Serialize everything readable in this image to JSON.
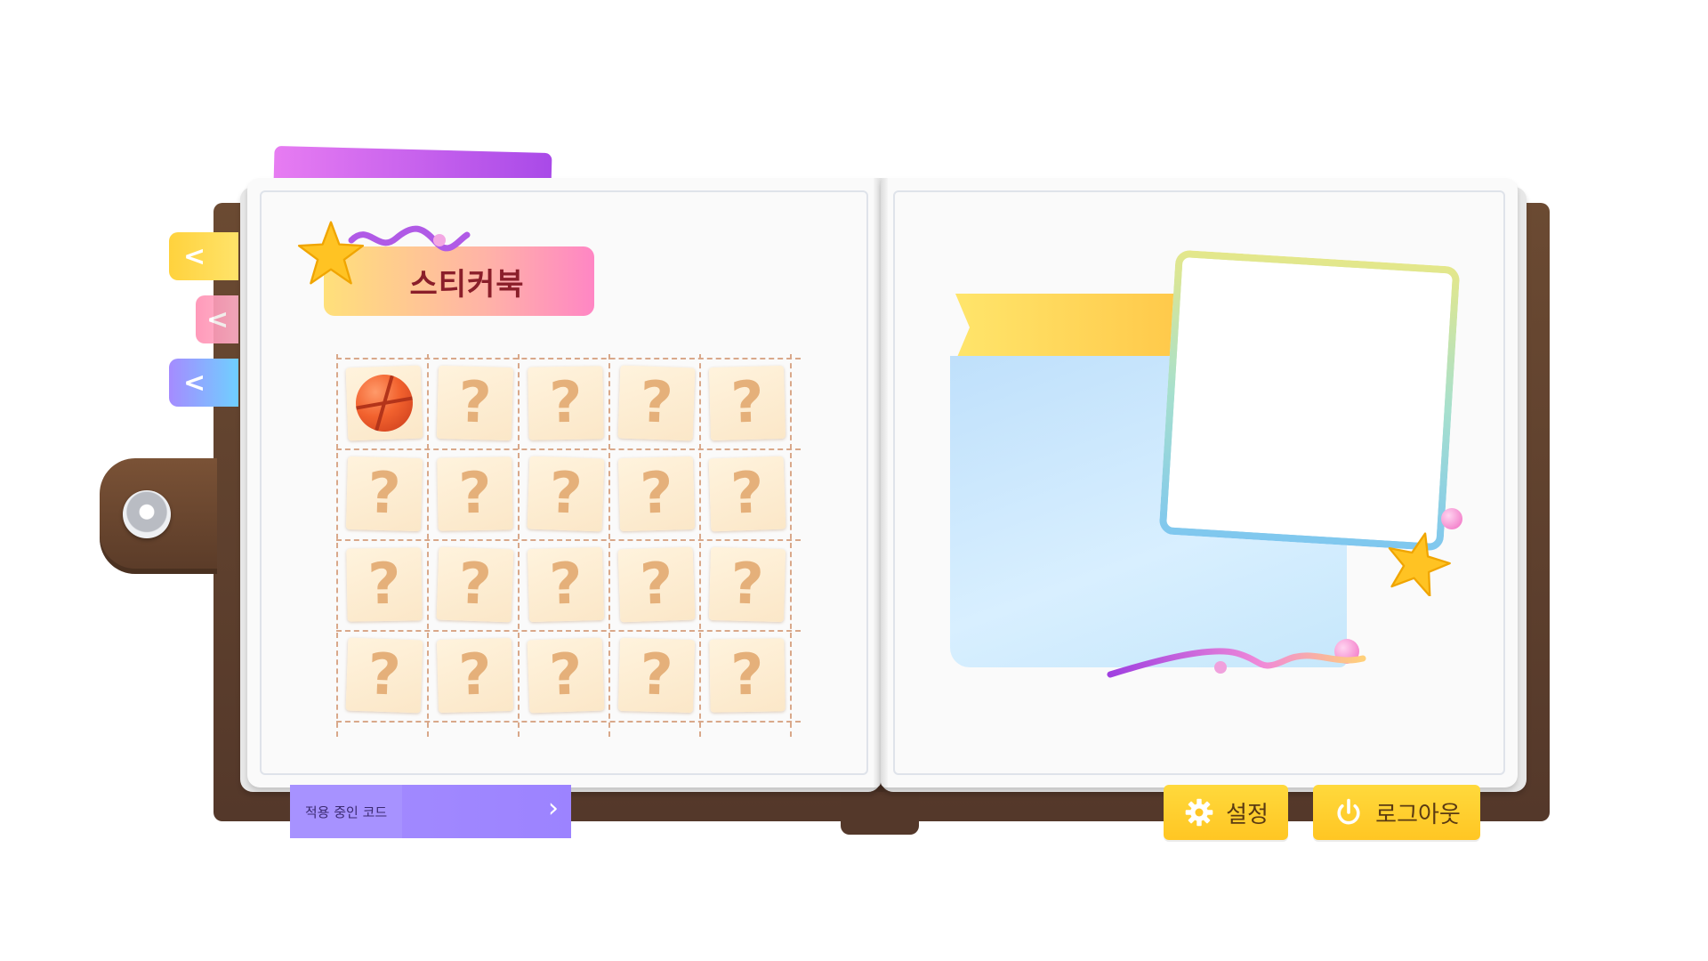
{
  "title": "스티커북",
  "side_tabs": [
    {
      "label": "<",
      "color": "#ffd23d"
    },
    {
      "label": "<",
      "color": "#ff8fb2"
    },
    {
      "label": "<",
      "color": "#8fa6ff"
    }
  ],
  "sticker_grid": {
    "rows": 4,
    "cols": 5,
    "unknown_symbol": "?",
    "unlocked": [
      {
        "row": 0,
        "col": 0,
        "sticker": "basketball-icon"
      }
    ]
  },
  "code_bar": {
    "label": "적용 중인 코드",
    "arrow": "›"
  },
  "buttons": {
    "settings": "설정",
    "logout": "로그아웃"
  },
  "colors": {
    "accent_yellow": "#ffc623",
    "accent_purple": "#a48cff",
    "title_text": "#8a1e2a",
    "book_cover": "#5a3b28"
  }
}
